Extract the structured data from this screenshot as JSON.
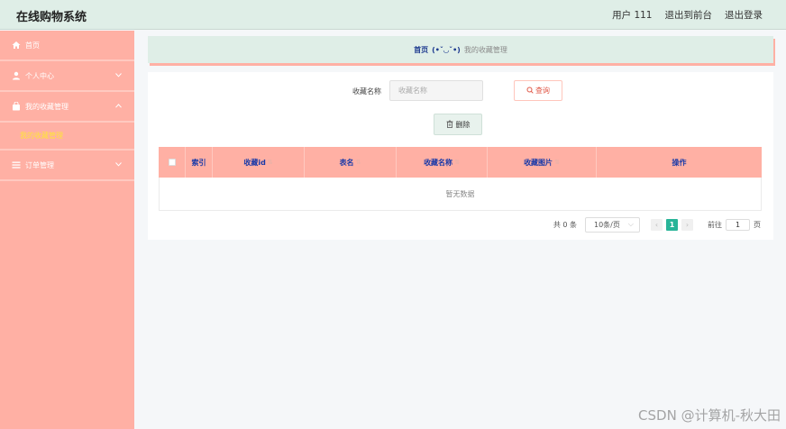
{
  "header": {
    "brand": "在线购物系统",
    "user": "用户 111",
    "to_front": "退出到前台",
    "logout": "退出登录"
  },
  "sidebar": {
    "items": [
      {
        "label": "首页",
        "icon": "home-icon"
      },
      {
        "label": "个人中心",
        "icon": "user-icon"
      },
      {
        "label": "我的收藏管理",
        "icon": "bag-icon"
      },
      {
        "label": "订单管理",
        "icon": "list-icon"
      }
    ],
    "submenu": {
      "label": "我的收藏管理"
    }
  },
  "breadcrumb": {
    "home": "首页",
    "face": "(•ˇ◡ˇ•)",
    "current": "我的收藏管理"
  },
  "search": {
    "label": "收藏名称",
    "placeholder": "收藏名称",
    "button": "查询"
  },
  "toolbar": {
    "delete": "删除"
  },
  "table": {
    "columns": [
      "索引",
      "收藏id",
      "表名",
      "收藏名称",
      "收藏图片",
      "操作"
    ],
    "empty_text": "暂无数据"
  },
  "pagination": {
    "total": "共 0 条",
    "page_size": "10条/页",
    "current_page": "1",
    "goto_label": "前往",
    "goto_value": "1",
    "page_unit": "页"
  },
  "watermark": "CSDN @计算机-秋大田",
  "colors": {
    "sidebar": "#ffb0a4",
    "header": "#dfeee7",
    "accent": "#28b498",
    "submenu_active": "#ffe43a"
  }
}
